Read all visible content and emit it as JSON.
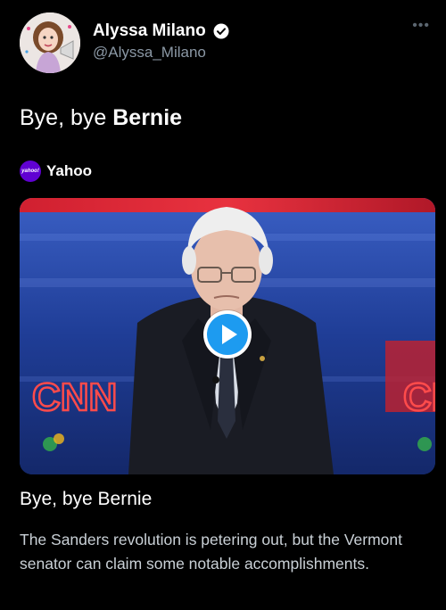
{
  "author": {
    "display_name": "Alyssa Milano",
    "handle": "@Alyssa_Milano",
    "verified": true,
    "avatar_icon": "cartoon-avatar-icon"
  },
  "tweet": {
    "text_prefix": "Bye, bye ",
    "text_bold": "Bernie"
  },
  "link_card": {
    "source_name": "Yahoo",
    "source_logo_text": "yahoo!",
    "media_label": "CNN",
    "media_icon": "play-icon",
    "title": "Bye, bye Bernie",
    "description": "The Sanders revolution is petering out, but the Vermont senator can claim some notable accomplishments."
  },
  "colors": {
    "background": "#000000",
    "accent": "#1d9bf0",
    "secondary_text": "#8b98a5",
    "yahoo_purple": "#6001d2"
  }
}
